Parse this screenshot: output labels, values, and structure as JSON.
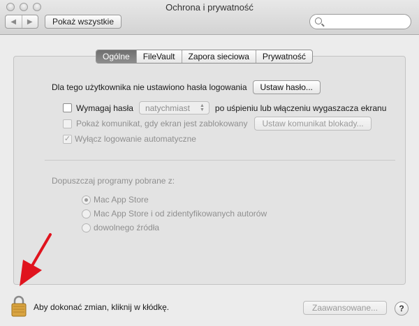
{
  "window": {
    "title": "Ochrona i prywatność"
  },
  "toolbar": {
    "back_icon": "◀",
    "forward_icon": "▶",
    "show_all_label": "Pokaż wszystkie"
  },
  "tabs": [
    {
      "label": "Ogólne",
      "active": true
    },
    {
      "label": "FileVault",
      "active": false
    },
    {
      "label": "Zapora sieciowa",
      "active": false
    },
    {
      "label": "Prywatność",
      "active": false
    }
  ],
  "general": {
    "no_password_text": "Dla tego użytkownika nie ustawiono hasła logowania",
    "set_password_button": "Ustaw hasło...",
    "require_password": {
      "label": "Wymagaj hasła",
      "popup_value": "natychmiast",
      "suffix": "po uśpieniu lub włączeniu wygaszacza ekranu",
      "checked": false
    },
    "lock_message": {
      "label": "Pokaż komunikat, gdy ekran jest zablokowany",
      "button": "Ustaw komunikat blokady...",
      "checked": false
    },
    "disable_autologin": {
      "label": "Wyłącz logowanie automatyczne",
      "checked": true
    }
  },
  "downloads": {
    "heading": "Dopuszczaj programy pobrane z:",
    "options": [
      {
        "label": "Mac App Store",
        "selected": true
      },
      {
        "label": "Mac App Store i od zidentyfikowanych autorów",
        "selected": false
      },
      {
        "label": "dowolnego źródła",
        "selected": false
      }
    ]
  },
  "footer": {
    "lock_text": "Aby dokonać zmian, kliknij w kłódkę.",
    "advanced_button": "Zaawansowane...",
    "help_label": "?"
  },
  "colors": {
    "arrow": "#e0141e",
    "active_tab": "#7a7a7a",
    "lock_gold": "#d9a441"
  }
}
